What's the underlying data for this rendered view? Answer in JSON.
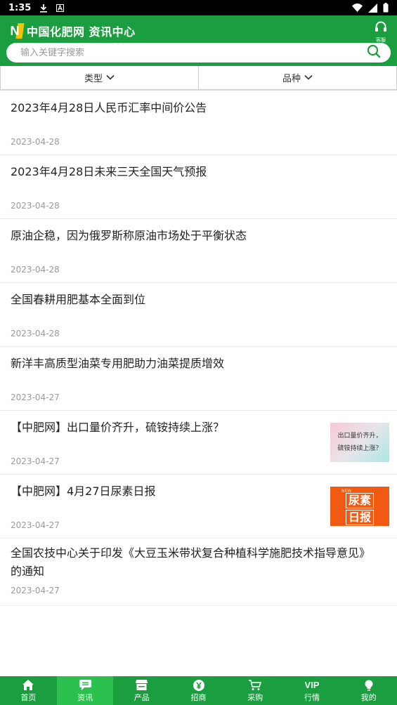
{
  "status_bar": {
    "time": "1:35"
  },
  "header": {
    "logo_letter": "N",
    "brand_title": "中国化肥网 资讯中心",
    "service_label": "客服",
    "search_placeholder": "输入关键字搜索"
  },
  "filters": [
    {
      "label": "类型"
    },
    {
      "label": "品种"
    }
  ],
  "news": [
    {
      "title": "2023年4月28日人民币汇率中间价公告",
      "date": "2023-04-28"
    },
    {
      "title": "2023年4月28日未来三天全国天气预报",
      "date": "2023-04-28"
    },
    {
      "title": "原油企稳，因为俄罗斯称原油市场处于平衡状态",
      "date": "2023-04-28"
    },
    {
      "title": "全国春耕用肥基本全面到位",
      "date": "2023-04-28"
    },
    {
      "title": "新洋丰高质型油菜专用肥助力油菜提质增效",
      "date": "2023-04-27"
    },
    {
      "title": "【中肥网】出口量价齐升，硫铵持续上涨？",
      "date": "2023-04-27",
      "thumb_line1": "出口量价齐升，",
      "thumb_line2": "硫铵持续上涨？"
    },
    {
      "title": "【中肥网】4月27日尿素日报",
      "date": "2023-04-27",
      "thumb_tag": "NEW",
      "thumb_line1": "尿素",
      "thumb_line2": "日报"
    },
    {
      "title": "全国农技中心关于印发《大豆玉米带状复合种植科学施肥技术指导意见》的通知",
      "date": "2023-04-27"
    }
  ],
  "bottom_nav": [
    {
      "label": "首页",
      "icon": "home-icon"
    },
    {
      "label": "资讯",
      "icon": "chat-icon",
      "active": true
    },
    {
      "label": "产品",
      "icon": "store-icon"
    },
    {
      "label": "招商",
      "icon": "yen-icon"
    },
    {
      "label": "采购",
      "icon": "cart-icon"
    },
    {
      "label": "行情",
      "icon": "vip-icon",
      "icon_text": "VIP"
    },
    {
      "label": "我的",
      "icon": "lightbulb-icon"
    }
  ],
  "colors": {
    "brand_green": "#1a9e3f",
    "active_green": "#2cc04f"
  }
}
